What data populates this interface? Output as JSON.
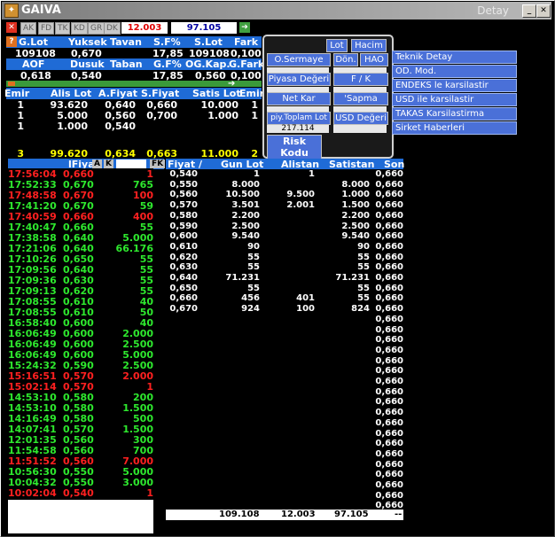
{
  "window": {
    "title": "GAIVA",
    "right_title": "Detay"
  },
  "toolbar": {
    "tabs": [
      "AK",
      "FD",
      "TK",
      "KD",
      "GR",
      "DK"
    ],
    "field1": "12.003",
    "field2": "97.105"
  },
  "summary": {
    "row1_headers": [
      "G.Lot",
      "Yuksek",
      "Tavan",
      "S.F%",
      "S.Lot",
      "Fark"
    ],
    "row1_values": [
      "109108",
      "0,670",
      "",
      "17,85",
      "109108",
      "0,100"
    ],
    "row2_headers": [
      "AOF",
      "Dusuk",
      "Taban",
      "G.F%",
      "OG.Kap.",
      "G.Fark"
    ],
    "row2_values": [
      "0,618",
      "0,540",
      "",
      "17,85",
      "0,560",
      "0,100"
    ]
  },
  "orders": {
    "headers": [
      "Emir",
      "Alis Lot",
      "A.Fiyat",
      "S.Fiyat",
      "Satis Lot",
      "Emir"
    ],
    "rows": [
      [
        "1",
        "93.620",
        "0,640",
        "0,660",
        "10.000",
        "1"
      ],
      [
        "1",
        "5.000",
        "0,560",
        "0,700",
        "1.000",
        "1"
      ],
      [
        "1",
        "1.000",
        "0,540",
        "",
        "",
        ""
      ]
    ],
    "total": [
      "3",
      "99.620",
      "0,634",
      "0,663",
      "11.000",
      "2"
    ]
  },
  "popup": {
    "lot": "Lot",
    "hacim": "Hacim",
    "osermaye": "O.Sermaye",
    "don": "Dön.",
    "hao": "HAO",
    "piyasa": "Piyasa Değeri",
    "fk": "F / K",
    "netkar": "Net Kar",
    "sapma": "'Sapma",
    "piytoplam": "piy.Toplam Lot",
    "usd": "USD Değeri",
    "piytoplam_value": "217.114",
    "risk": "Risk Kodu"
  },
  "right_menu": [
    "Teknik Detay",
    "OD. Mod.",
    "ENDEKS le karsilastir",
    "USD ile karsilastir",
    "TAKAS Karsilastirma",
    "Sirket Haberleri"
  ],
  "trades_header": {
    "fiyat": "lFiyat",
    "a": "A",
    "k": "K",
    "fk": "FK"
  },
  "trades": [
    [
      "17:56:04",
      "0,660",
      "1",
      "red"
    ],
    [
      "17:52:33",
      "0,670",
      "765",
      "green"
    ],
    [
      "17:48:58",
      "0,670",
      "100",
      "red"
    ],
    [
      "17:41:20",
      "0,670",
      "59",
      "green"
    ],
    [
      "17:40:59",
      "0,660",
      "400",
      "red"
    ],
    [
      "17:40:47",
      "0,660",
      "55",
      "green"
    ],
    [
      "17:38:58",
      "0,640",
      "5.000",
      "green"
    ],
    [
      "17:21:06",
      "0,640",
      "66.176",
      "green"
    ],
    [
      "17:10:26",
      "0,650",
      "55",
      "green"
    ],
    [
      "17:09:56",
      "0,640",
      "55",
      "green"
    ],
    [
      "17:09:36",
      "0,630",
      "55",
      "green"
    ],
    [
      "17:09:13",
      "0,620",
      "55",
      "green"
    ],
    [
      "17:08:55",
      "0,610",
      "40",
      "green"
    ],
    [
      "17:08:55",
      "0,610",
      "50",
      "green"
    ],
    [
      "16:58:40",
      "0,600",
      "40",
      "green"
    ],
    [
      "16:06:49",
      "0,600",
      "2.000",
      "green"
    ],
    [
      "16:06:49",
      "0,600",
      "2.500",
      "green"
    ],
    [
      "16:06:49",
      "0,600",
      "5.000",
      "green"
    ],
    [
      "15:24:32",
      "0,590",
      "2.500",
      "green"
    ],
    [
      "15:16:51",
      "0,570",
      "2.000",
      "red"
    ],
    [
      "15:02:14",
      "0,570",
      "1",
      "red"
    ],
    [
      "14:53:10",
      "0,580",
      "200",
      "green"
    ],
    [
      "14:53:10",
      "0,580",
      "1.500",
      "green"
    ],
    [
      "14:16:49",
      "0,580",
      "500",
      "green"
    ],
    [
      "14:07:41",
      "0,570",
      "1.500",
      "green"
    ],
    [
      "12:01:35",
      "0,560",
      "300",
      "green"
    ],
    [
      "11:54:58",
      "0,560",
      "700",
      "green"
    ],
    [
      "11:51:52",
      "0,560",
      "7.000",
      "red"
    ],
    [
      "10:56:30",
      "0,550",
      "5.000",
      "green"
    ],
    [
      "10:04:32",
      "0,550",
      "3.000",
      "green"
    ],
    [
      "10:02:04",
      "0,540",
      "1",
      "red"
    ]
  ],
  "depth_headers": [
    "Fiyat /",
    "Gun Lot",
    "Alistan",
    "Satistan",
    "Son"
  ],
  "depth": [
    [
      "0,540",
      "1",
      "1",
      "",
      "0,660"
    ],
    [
      "0,550",
      "8.000",
      "",
      "8.000",
      "0,660"
    ],
    [
      "0,560",
      "10.500",
      "9.500",
      "1.000",
      "0,660"
    ],
    [
      "0,570",
      "3.501",
      "2.001",
      "1.500",
      "0,660"
    ],
    [
      "0,580",
      "2.200",
      "",
      "2.200",
      "0,660"
    ],
    [
      "0,590",
      "2.500",
      "",
      "2.500",
      "0,660"
    ],
    [
      "0,600",
      "9.540",
      "",
      "9.540",
      "0,660"
    ],
    [
      "0,610",
      "90",
      "",
      "90",
      "0,660"
    ],
    [
      "0,620",
      "55",
      "",
      "55",
      "0,660"
    ],
    [
      "0,630",
      "55",
      "",
      "55",
      "0,660"
    ],
    [
      "0,640",
      "71.231",
      "",
      "71.231",
      "0,660"
    ],
    [
      "0,650",
      "55",
      "",
      "55",
      "0,660"
    ],
    [
      "0,660",
      "456",
      "401",
      "55",
      "0,660"
    ],
    [
      "0,670",
      "924",
      "100",
      "824",
      "0,660"
    ]
  ],
  "son_extra": [
    "0,660",
    "0,660",
    "0,660",
    "0,660",
    "0,660",
    "0,660",
    "0,660",
    "0,660",
    "0,660",
    "0,660",
    "0,660",
    "0,660",
    "0,660",
    "0,660",
    "0,660",
    "0,660",
    "0,660",
    "0,660",
    "0,660",
    "0,660",
    "0,660",
    "0,660",
    "0,660",
    "0,660",
    "0,660",
    "0,660",
    "0,660",
    "0,660",
    "0,660",
    "0,660",
    "0,660",
    "0,660",
    "0,660",
    "0,660",
    "0,660"
  ],
  "depth_totals": [
    "109.108",
    "12.003",
    "97.105",
    "--"
  ]
}
